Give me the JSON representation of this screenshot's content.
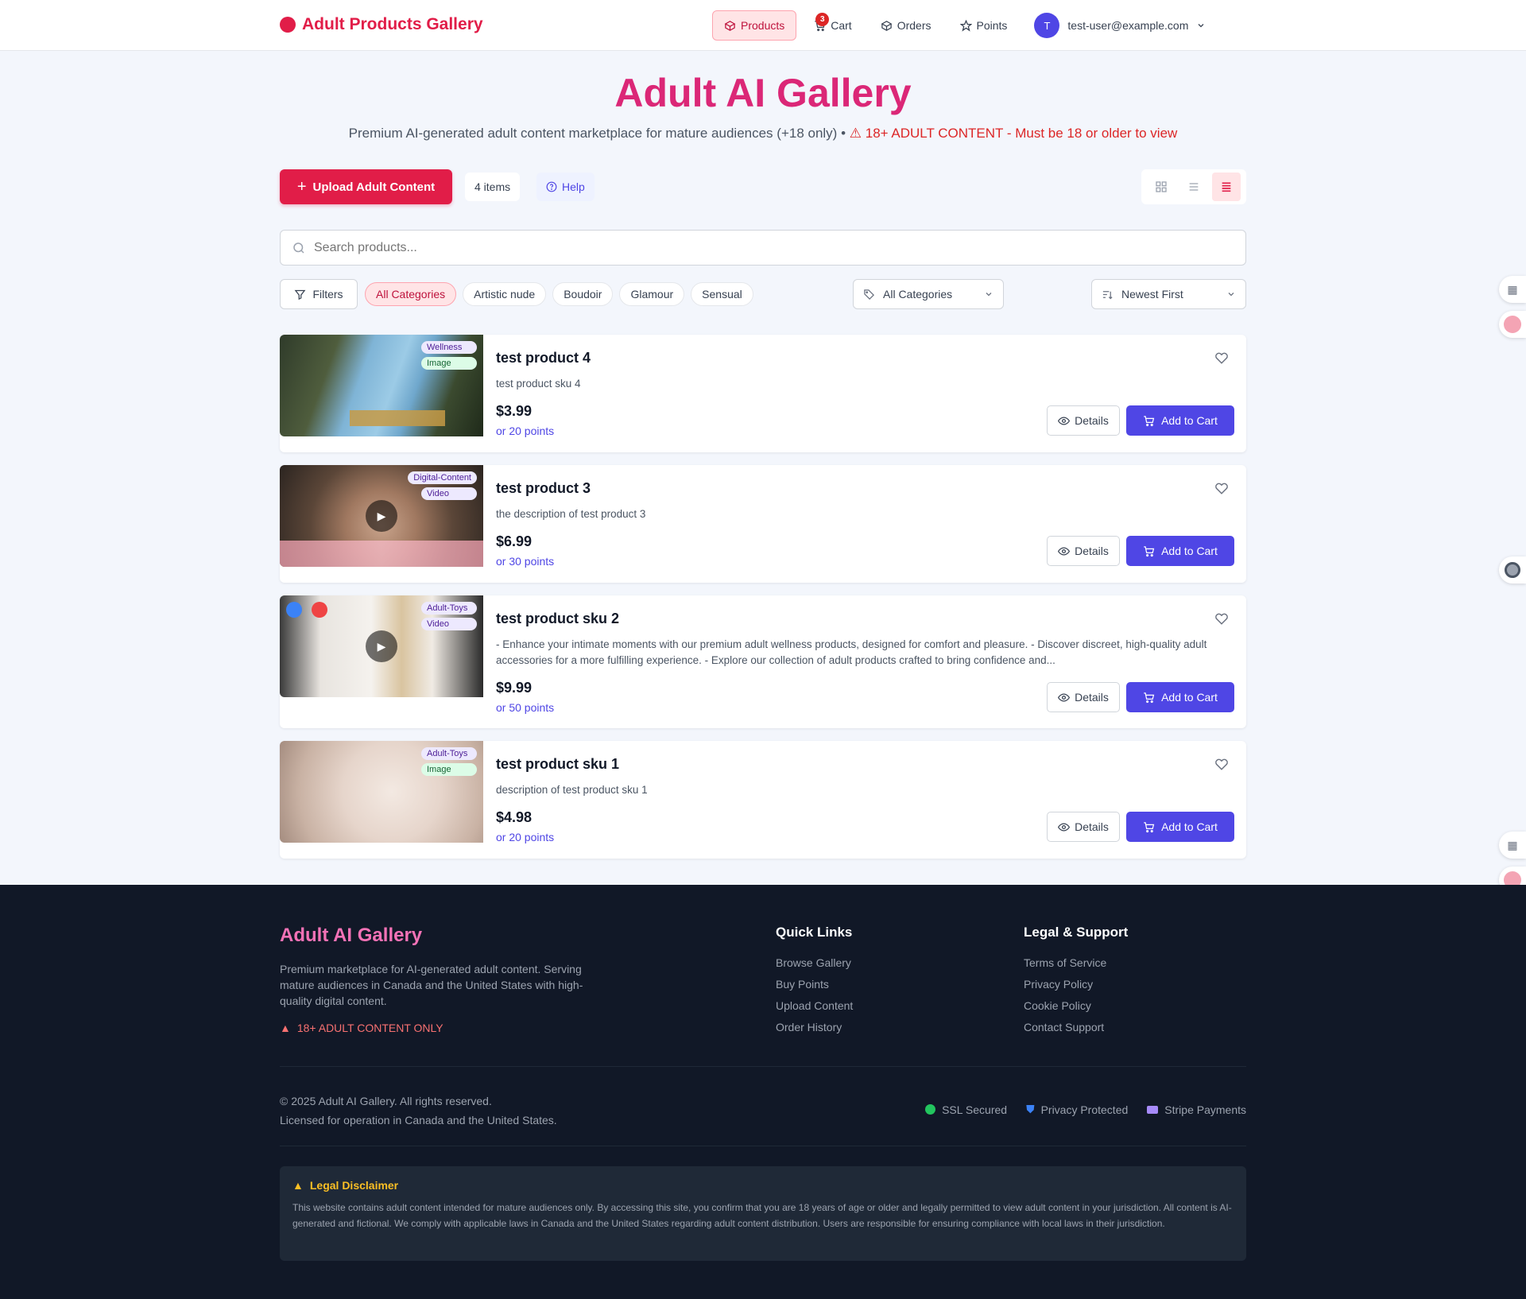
{
  "nav": {
    "brand": "Adult Products Gallery",
    "links": [
      {
        "label": "Products"
      },
      {
        "label": "Cart",
        "badge": "3"
      },
      {
        "label": "Orders"
      },
      {
        "label": "Points"
      }
    ],
    "user_initial": "T",
    "user_email": "test-user@example.com"
  },
  "hero": {
    "title": "Adult AI Gallery",
    "subtitle": "Premium AI-generated adult content marketplace for mature audiences (+18 only) •",
    "warning": "18+ ADULT CONTENT - Must be 18 or older to view"
  },
  "toolbar": {
    "upload_label": "Upload Adult Content",
    "items_count": "4 items",
    "help_label": "Help"
  },
  "search": {
    "placeholder": "Search products..."
  },
  "filters": {
    "filters_label": "Filters",
    "chips": [
      "All Categories",
      "Artistic nude",
      "Boudoir",
      "Glamour",
      "Sensual"
    ],
    "category_select": "All Categories",
    "sort_select": "Newest First"
  },
  "products": [
    {
      "title": "test product 4",
      "description": "test product sku 4",
      "price": "$3.99",
      "points": "or 20 points",
      "category": "Wellness",
      "media": "Image"
    },
    {
      "title": "test product 3",
      "description": "the description of test product 3",
      "price": "$6.99",
      "points": "or 30 points",
      "category": "Digital-Content",
      "media": "Video"
    },
    {
      "title": "test product sku 2",
      "description": "- Enhance your intimate moments with our premium adult wellness products, designed for comfort and pleasure. - Discover discreet, high-quality adult accessories for a more fulfilling experience. - Explore our collection of adult products crafted to bring confidence and...",
      "price": "$9.99",
      "points": "or 50 points",
      "category": "Adult-Toys",
      "media": "Video"
    },
    {
      "title": "test product sku 1",
      "description": "description of test product sku 1",
      "price": "$4.98",
      "points": "or 20 points",
      "category": "Adult-Toys",
      "media": "Image"
    }
  ],
  "buttons": {
    "details": "Details",
    "add_to_cart": "Add to Cart"
  },
  "footer": {
    "brand": "Adult AI Gallery",
    "description": "Premium marketplace for AI-generated adult content. Serving mature audiences in Canada and the United States with high-quality digital content.",
    "adult_notice": "18+ ADULT CONTENT ONLY",
    "quick_links_title": "Quick Links",
    "quick_links": [
      "Browse Gallery",
      "Buy Points",
      "Upload Content",
      "Order History"
    ],
    "legal_title": "Legal & Support",
    "legal_links": [
      "Terms of Service",
      "Privacy Policy",
      "Cookie Policy",
      "Contact Support"
    ],
    "copyright": "© 2025 Adult AI Gallery. All rights reserved.",
    "license": "Licensed for operation in Canada and the United States.",
    "badges": [
      "SSL Secured",
      "Privacy Protected",
      "Stripe Payments"
    ],
    "disclaimer_title": "Legal Disclaimer",
    "disclaimer_text": "This website contains adult content intended for mature audiences only. By accessing this site, you confirm that you are 18 years of age or older and legally permitted to view adult content in your jurisdiction. All content is AI-generated and fictional. We comply with applicable laws in Canada and the United States regarding adult content distribution. Users are responsible for ensuring compliance with local laws in their jurisdiction."
  },
  "colors": {
    "brand": "#e11d48",
    "accent": "#4f46e5",
    "footer_bg": "#111827"
  }
}
